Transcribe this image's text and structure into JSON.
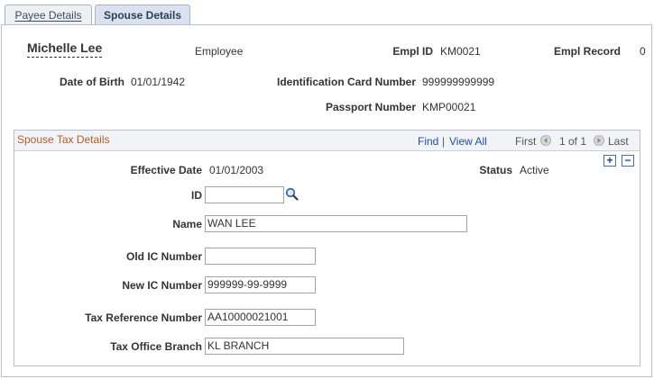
{
  "tabs": {
    "payee": "Payee Details",
    "spouse": "Spouse Details"
  },
  "header": {
    "name": "Michelle Lee",
    "role": "Employee",
    "empl_id_label": "Empl ID",
    "empl_id": "KM0021",
    "empl_record_label": "Empl Record",
    "empl_record": "0",
    "dob_label": "Date of Birth",
    "dob": "01/01/1942",
    "id_card_label": "Identification Card Number",
    "id_card": "999999999999",
    "passport_label": "Passport Number",
    "passport": "KMP00021"
  },
  "group": {
    "title": "Spouse Tax Details",
    "find": "Find",
    "sep": "|",
    "view_all": "View All",
    "first": "First",
    "pager": "1 of 1",
    "last": "Last",
    "add": "+",
    "remove": "−"
  },
  "form": {
    "effective_date_label": "Effective Date",
    "effective_date": "01/01/2003",
    "status_label": "Status",
    "status": "Active",
    "id_label": "ID",
    "id_value": "",
    "name_label": "Name",
    "name_value": "WAN LEE",
    "old_ic_label": "Old IC Number",
    "old_ic_value": "",
    "new_ic_label": "New IC Number",
    "new_ic_value": "999999-99-9999",
    "tax_ref_label": "Tax Reference Number",
    "tax_ref_value": "AA10000021001",
    "tax_office_label": "Tax Office Branch",
    "tax_office_value": "KL BRANCH"
  },
  "icons": {
    "lookup": "magnifier-icon",
    "prev": "left-arrow-icon",
    "next": "right-arrow-icon"
  }
}
